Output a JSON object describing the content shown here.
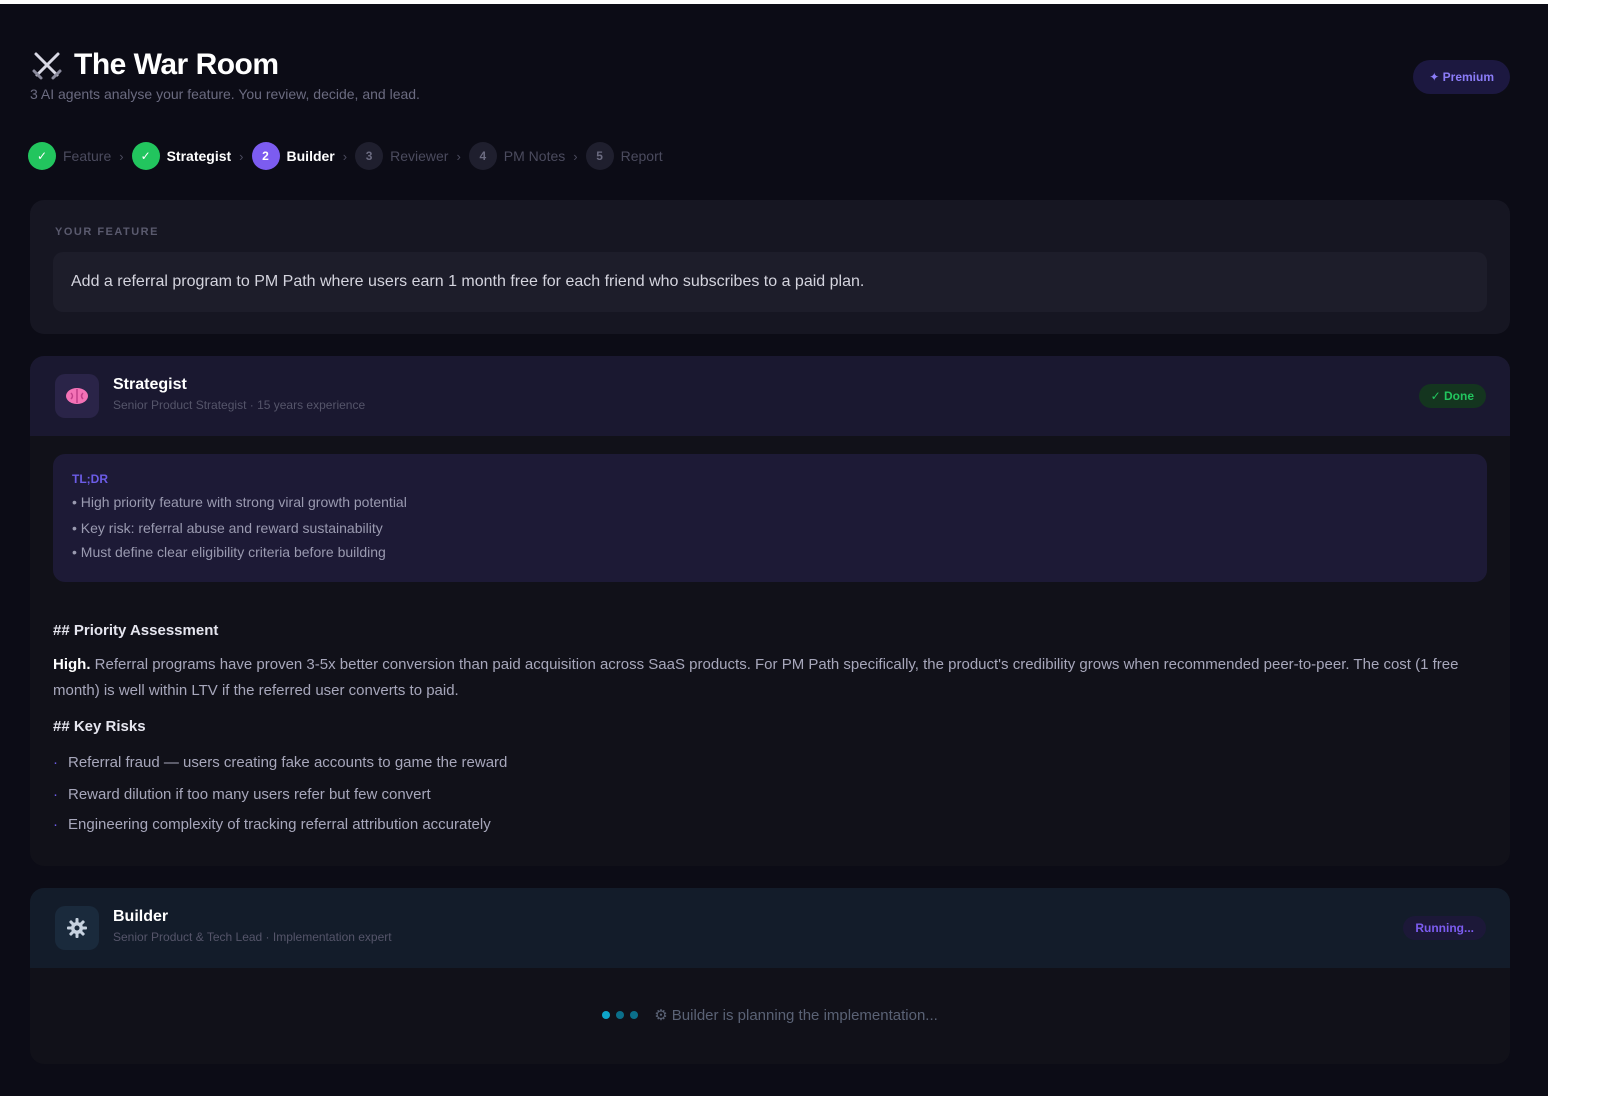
{
  "header": {
    "title": "The War Room",
    "subtitle": "3 AI agents analyse your feature. You review, decide, and lead.",
    "premium_label": "✦ Premium"
  },
  "steps": [
    {
      "number": "✓",
      "label": "Feature",
      "state": "done"
    },
    {
      "number": "✓",
      "label": "Strategist",
      "state": "done"
    },
    {
      "number": "2",
      "label": "Builder",
      "state": "active"
    },
    {
      "number": "3",
      "label": "Reviewer",
      "state": "pending"
    },
    {
      "number": "4",
      "label": "PM Notes",
      "state": "pending"
    },
    {
      "number": "5",
      "label": "Report",
      "state": "pending"
    }
  ],
  "feature": {
    "section_label": "YOUR FEATURE",
    "text": "Add a referral program to PM Path where users earn 1 month free for each friend who subscribes to a paid plan."
  },
  "strategist": {
    "name": "Strategist",
    "subtitle": "Senior Product Strategist · 15 years experience",
    "status": "✓ Done",
    "icon": "brain-icon",
    "tldr_label": "TL;DR",
    "tldr_items": [
      "• High priority feature with strong viral growth potential",
      "• Key risk: referral abuse and reward sustainability",
      "• Must define clear eligibility criteria before building"
    ],
    "priority_heading": "## Priority Assessment",
    "priority_lead": "High.",
    "priority_body": "Referral programs have proven 3-5x better conversion than paid acquisition across SaaS products. For PM Path specifically, the product's credibility grows when recommended peer-to-peer. The cost (1 free month) is well within LTV if the referred user converts to paid.",
    "risks_heading": "## Key Risks",
    "risks": [
      "Referral fraud — users creating fake accounts to game the reward",
      "Reward dilution if too many users refer but few convert",
      "Engineering complexity of tracking referral attribution accurately"
    ]
  },
  "builder": {
    "name": "Builder",
    "subtitle": "Senior Product & Tech Lead · Implementation expert",
    "status": "Running...",
    "icon": "gear-icon",
    "loading_text": "⚙ Builder is planning the implementation..."
  },
  "colors": {
    "background": "#0c0c16",
    "accent": "#7c5cf0",
    "done": "#22c55e",
    "loader": "#0ea5c9"
  }
}
